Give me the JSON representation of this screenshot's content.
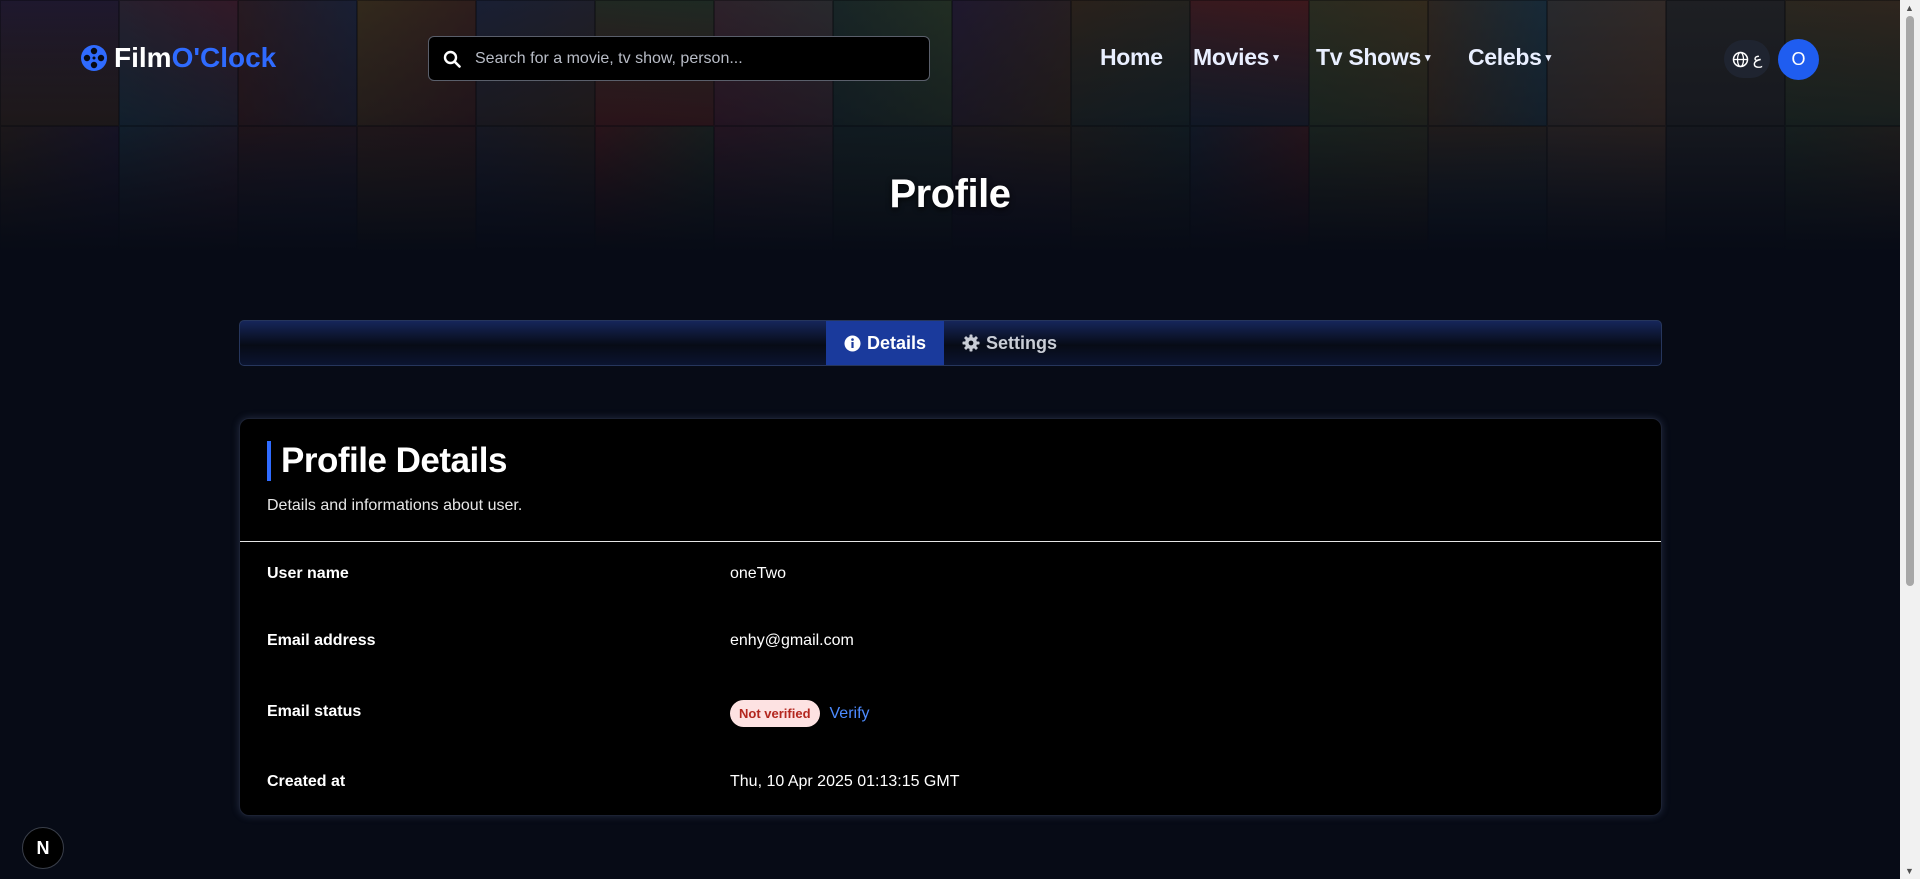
{
  "brand": {
    "name_part1": "Film",
    "name_part2": "O'Clock",
    "accent_color": "#2f6bff"
  },
  "search": {
    "placeholder": "Search for a movie, tv show, person..."
  },
  "nav": {
    "home": "Home",
    "movies": "Movies",
    "tv_shows": "Tv Shows",
    "celebs": "Celebs",
    "caret": "▾"
  },
  "lang": {
    "glyph": "ع"
  },
  "user": {
    "avatar_initial": "O"
  },
  "hero": {
    "title": "Profile"
  },
  "tabs": [
    {
      "label": "Details",
      "icon": "info-icon",
      "active": true
    },
    {
      "label": "Settings",
      "icon": "gear-icon",
      "active": false
    }
  ],
  "card": {
    "title": "Profile Details",
    "subtitle": "Details and informations about user.",
    "rows": [
      {
        "label": "User name",
        "value": "oneTwo"
      },
      {
        "label": "Email address",
        "value": "enhy@gmail.com"
      },
      {
        "label": "Email status",
        "badge": "Not verified",
        "action": "Verify"
      },
      {
        "label": "Created at",
        "value": "Thu, 10 Apr 2025 01:13:15 GMT"
      }
    ]
  },
  "dev_badge": {
    "label": "N"
  }
}
